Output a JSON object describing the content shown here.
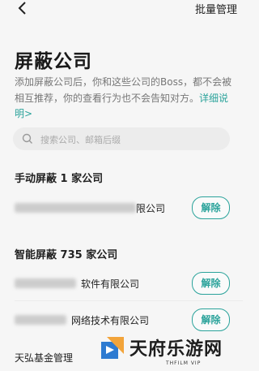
{
  "header": {
    "batch_label": "批量管理"
  },
  "page": {
    "title": "屏蔽公司",
    "description": "添加屏蔽公司后，你和这些公司的Boss，都不会被相互推荐，你的查看行为也不会告知对方。",
    "details_link": "详细说明>"
  },
  "search": {
    "placeholder": "搜索公司、邮箱后缀"
  },
  "manual": {
    "title": "手动屏蔽 1 家公司",
    "items": [
      {
        "suffix": "限公司",
        "action": "解除"
      }
    ]
  },
  "smart": {
    "title": "智能屏蔽 735 家公司",
    "items": [
      {
        "suffix": "软件有限公司",
        "action": "解除"
      },
      {
        "suffix": "网络技术有限公司",
        "action": "解除"
      }
    ]
  },
  "partial_item": {
    "name": "天弘基金管理"
  },
  "watermark": {
    "text": "天府乐游网",
    "sub": "THFILM VIP"
  },
  "colors": {
    "accent": "#2ba39b",
    "background": "#f6f6f6"
  }
}
